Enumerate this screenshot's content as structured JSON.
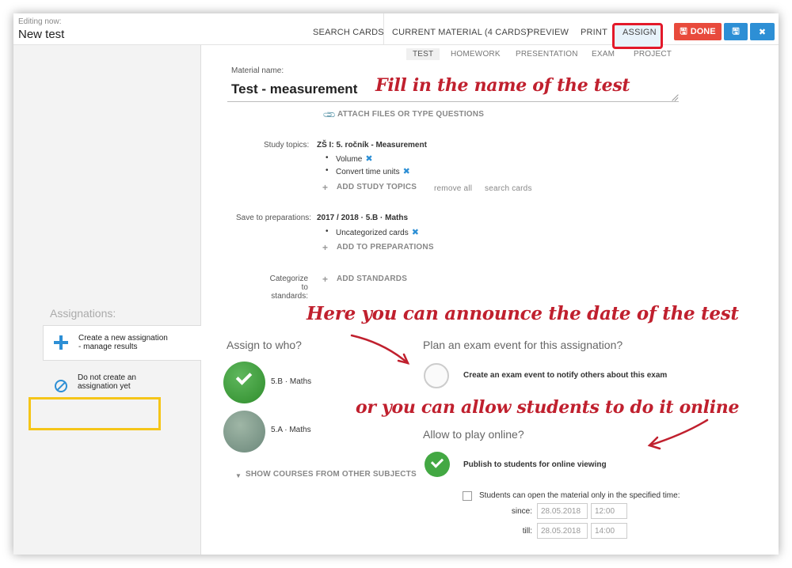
{
  "header": {
    "editing_label": "Editing now:",
    "title": "New test",
    "nav": [
      {
        "label": "SEARCH CARDS"
      },
      {
        "label": "CURRENT MATERIAL (4 CARDS)"
      },
      {
        "label": "PREVIEW"
      },
      {
        "label": "PRINT"
      },
      {
        "label": "ASSIGN"
      }
    ],
    "done_label": "DONE"
  },
  "material_tabs": [
    "TEST",
    "HOMEWORK",
    "PRESENTATION",
    "EXAM",
    "PROJECT"
  ],
  "form": {
    "name_label": "Material name:",
    "name_value": "Test - measurement",
    "attach_label": "ATTACH FILES OR TYPE QUESTIONS",
    "study_topics_label": "Study topics:",
    "study_topics_value": "ZŠ I: 5. ročník - Measurement",
    "topics": [
      "Volume",
      "Convert time units"
    ],
    "add_topics_label": "ADD STUDY TOPICS",
    "remove_all_label": "remove all",
    "search_cards_label": "search cards",
    "save_to_label": "Save to preparations:",
    "save_to_value": "2017 / 2018 · 5.B · Maths",
    "preparations": [
      "Uncategorized cards"
    ],
    "add_preparations_label": "ADD TO PREPARATIONS",
    "categorize_label_1": "Categorize to",
    "categorize_label_2": "standards:",
    "add_standards_label": "ADD STANDARDS"
  },
  "sidebar": {
    "heading": "Assignations:",
    "items": [
      {
        "line1": "Create a new assignation",
        "line2": "- manage results"
      },
      {
        "line1": "Do not create an",
        "line2": "assignation yet"
      }
    ]
  },
  "assign": {
    "heading": "Assign to who?",
    "courses": [
      "5.B · Maths",
      "5.A · Maths"
    ],
    "show_more_label": "SHOW COURSES FROM OTHER SUBJECTS"
  },
  "exam_event": {
    "heading": "Plan an exam event for this assignation?",
    "option": "Create an exam event to notify others about this exam"
  },
  "online": {
    "heading": "Allow to play online?",
    "option": "Publish to students for online viewing",
    "time_limit_label": "Students can open the material only in the specified time:",
    "since_label": "since:",
    "till_label": "till:",
    "since_date": "28.05.2018",
    "since_time": "12:00",
    "till_date": "28.05.2018",
    "till_time": "14:00"
  },
  "annotations": {
    "fill_name": "Fill in the name of the test",
    "announce_date": "Here you can announce the date of the test",
    "allow_online": "or you can allow students to do it online"
  },
  "colors": {
    "accent_blue": "#2d8fd5",
    "done_red": "#e84a3c",
    "highlight_red": "#e3192a",
    "highlight_yellow": "#f5c518",
    "success_green": "#43a843"
  }
}
